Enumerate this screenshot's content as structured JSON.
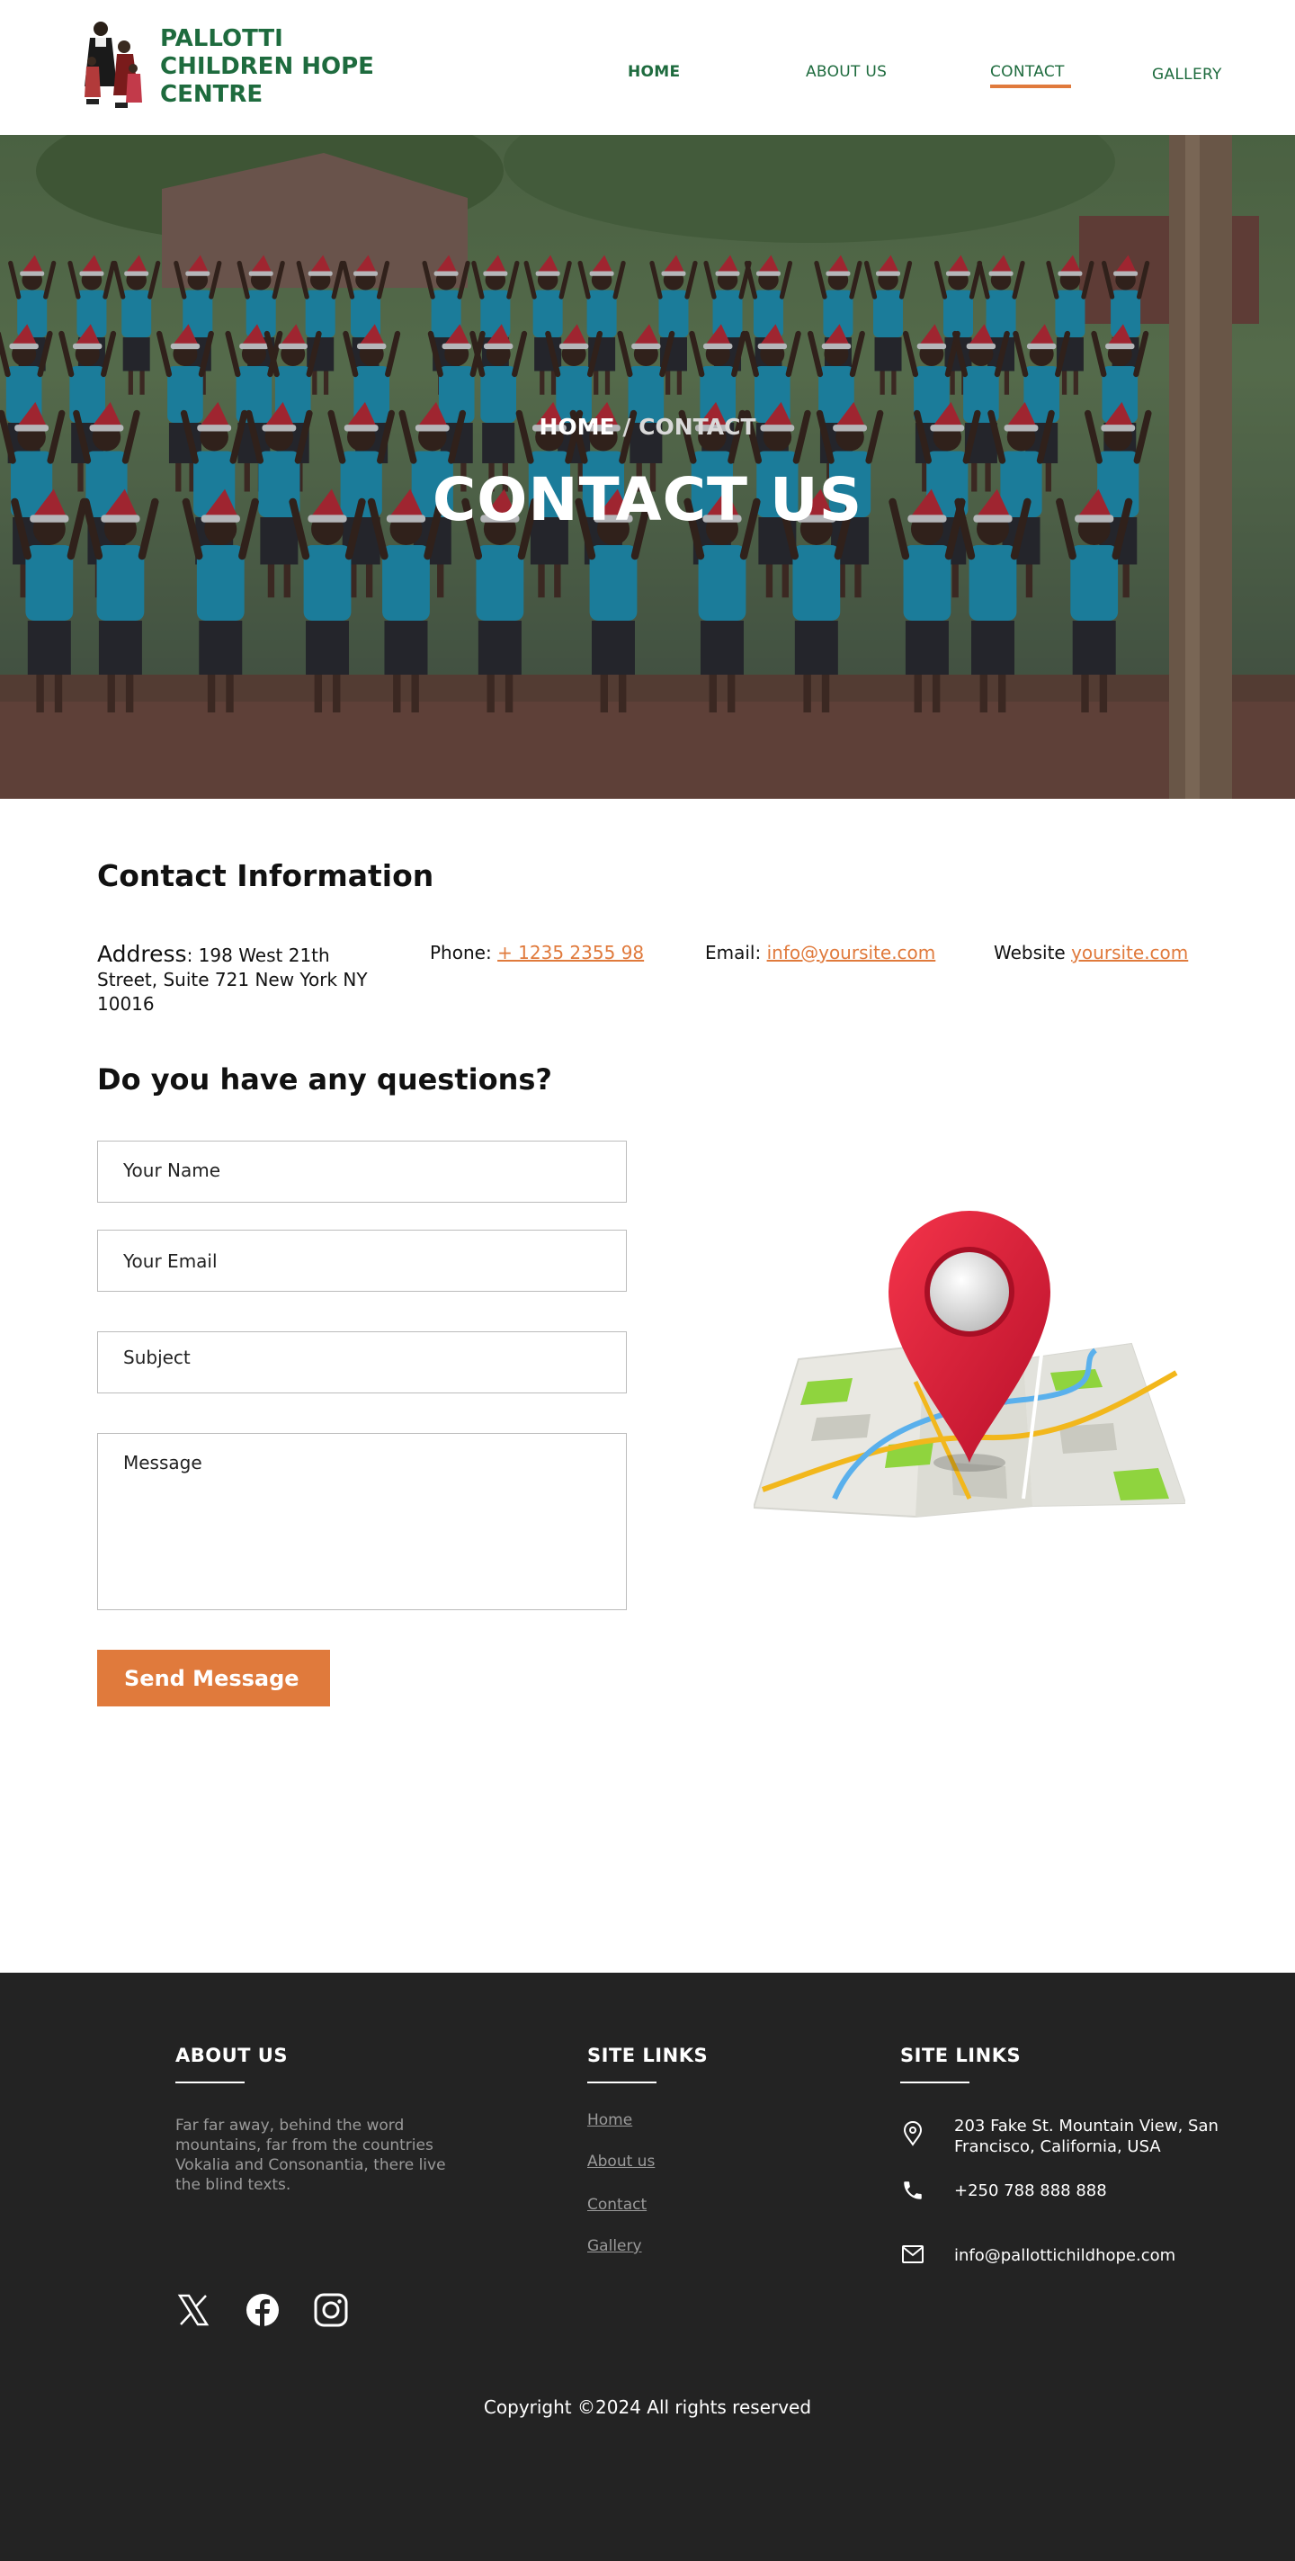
{
  "header": {
    "brand_lines": [
      "PALLOTTI",
      "CHILDREN HOPE",
      "CENTRE"
    ],
    "nav": {
      "home": "HOME",
      "about": "ABOUT US",
      "contact": "CONTACT",
      "gallery": "GALLERY"
    }
  },
  "hero": {
    "breadcrumb_home": "HOME",
    "breadcrumb_current": "/ CONTACT",
    "title": "CONTACT US"
  },
  "contact_info": {
    "title": "Contact Information",
    "address_label": "Address",
    "address_value": ": 198 West 21th Street, Suite 721 New York NY 10016",
    "phone_label": "Phone: ",
    "phone_value": "+ 1235 2355 98",
    "email_label": "Email: ",
    "email_value": "info@yoursite.com",
    "website_label": "Website ",
    "website_value": "yoursite.com"
  },
  "form": {
    "title": "Do you have any questions?",
    "name_placeholder": "Your Name",
    "email_placeholder": "Your Email",
    "subject_placeholder": "Subject",
    "message_placeholder": "Message",
    "send_label": "Send Message"
  },
  "footer": {
    "about_heading": "ABOUT US",
    "about_text": "Far far away, behind the word mountains, far from the countries Vokalia and Consonantia, there live the blind texts.",
    "links_heading": "SITE LINKS",
    "links": [
      "Home",
      "About us",
      "Contact",
      "Gallery"
    ],
    "contact_heading": "SITE LINKS",
    "address": "203 Fake St. Mountain View, San Francisco, California, USA",
    "phone": "+250 788 888 888",
    "email": "info@pallottichildhope.com",
    "social_icons": [
      "x-icon",
      "facebook-icon",
      "instagram-icon"
    ],
    "copyright": "Copyright ©2024 All rights reserved"
  },
  "colors": {
    "brand_green": "#1e6b3e",
    "accent_orange": "#e07a3c",
    "footer_bg": "#232323"
  }
}
